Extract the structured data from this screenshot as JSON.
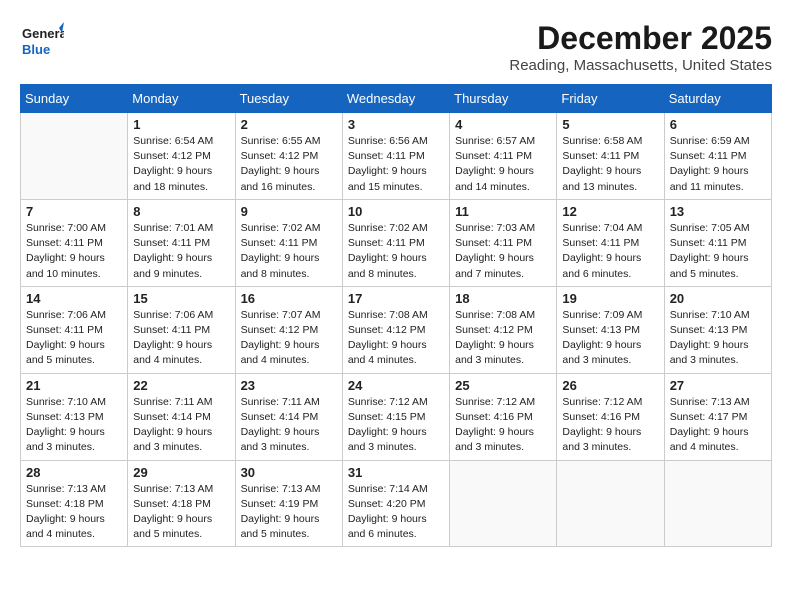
{
  "logo": {
    "line1": "General",
    "line2": "Blue"
  },
  "title": "December 2025",
  "location": "Reading, Massachusetts, United States",
  "days_of_week": [
    "Sunday",
    "Monday",
    "Tuesday",
    "Wednesday",
    "Thursday",
    "Friday",
    "Saturday"
  ],
  "weeks": [
    [
      {
        "day": "",
        "info": ""
      },
      {
        "day": "1",
        "info": "Sunrise: 6:54 AM\nSunset: 4:12 PM\nDaylight: 9 hours\nand 18 minutes."
      },
      {
        "day": "2",
        "info": "Sunrise: 6:55 AM\nSunset: 4:12 PM\nDaylight: 9 hours\nand 16 minutes."
      },
      {
        "day": "3",
        "info": "Sunrise: 6:56 AM\nSunset: 4:11 PM\nDaylight: 9 hours\nand 15 minutes."
      },
      {
        "day": "4",
        "info": "Sunrise: 6:57 AM\nSunset: 4:11 PM\nDaylight: 9 hours\nand 14 minutes."
      },
      {
        "day": "5",
        "info": "Sunrise: 6:58 AM\nSunset: 4:11 PM\nDaylight: 9 hours\nand 13 minutes."
      },
      {
        "day": "6",
        "info": "Sunrise: 6:59 AM\nSunset: 4:11 PM\nDaylight: 9 hours\nand 11 minutes."
      }
    ],
    [
      {
        "day": "7",
        "info": "Sunrise: 7:00 AM\nSunset: 4:11 PM\nDaylight: 9 hours\nand 10 minutes."
      },
      {
        "day": "8",
        "info": "Sunrise: 7:01 AM\nSunset: 4:11 PM\nDaylight: 9 hours\nand 9 minutes."
      },
      {
        "day": "9",
        "info": "Sunrise: 7:02 AM\nSunset: 4:11 PM\nDaylight: 9 hours\nand 8 minutes."
      },
      {
        "day": "10",
        "info": "Sunrise: 7:02 AM\nSunset: 4:11 PM\nDaylight: 9 hours\nand 8 minutes."
      },
      {
        "day": "11",
        "info": "Sunrise: 7:03 AM\nSunset: 4:11 PM\nDaylight: 9 hours\nand 7 minutes."
      },
      {
        "day": "12",
        "info": "Sunrise: 7:04 AM\nSunset: 4:11 PM\nDaylight: 9 hours\nand 6 minutes."
      },
      {
        "day": "13",
        "info": "Sunrise: 7:05 AM\nSunset: 4:11 PM\nDaylight: 9 hours\nand 5 minutes."
      }
    ],
    [
      {
        "day": "14",
        "info": "Sunrise: 7:06 AM\nSunset: 4:11 PM\nDaylight: 9 hours\nand 5 minutes."
      },
      {
        "day": "15",
        "info": "Sunrise: 7:06 AM\nSunset: 4:11 PM\nDaylight: 9 hours\nand 4 minutes."
      },
      {
        "day": "16",
        "info": "Sunrise: 7:07 AM\nSunset: 4:12 PM\nDaylight: 9 hours\nand 4 minutes."
      },
      {
        "day": "17",
        "info": "Sunrise: 7:08 AM\nSunset: 4:12 PM\nDaylight: 9 hours\nand 4 minutes."
      },
      {
        "day": "18",
        "info": "Sunrise: 7:08 AM\nSunset: 4:12 PM\nDaylight: 9 hours\nand 3 minutes."
      },
      {
        "day": "19",
        "info": "Sunrise: 7:09 AM\nSunset: 4:13 PM\nDaylight: 9 hours\nand 3 minutes."
      },
      {
        "day": "20",
        "info": "Sunrise: 7:10 AM\nSunset: 4:13 PM\nDaylight: 9 hours\nand 3 minutes."
      }
    ],
    [
      {
        "day": "21",
        "info": "Sunrise: 7:10 AM\nSunset: 4:13 PM\nDaylight: 9 hours\nand 3 minutes."
      },
      {
        "day": "22",
        "info": "Sunrise: 7:11 AM\nSunset: 4:14 PM\nDaylight: 9 hours\nand 3 minutes."
      },
      {
        "day": "23",
        "info": "Sunrise: 7:11 AM\nSunset: 4:14 PM\nDaylight: 9 hours\nand 3 minutes."
      },
      {
        "day": "24",
        "info": "Sunrise: 7:12 AM\nSunset: 4:15 PM\nDaylight: 9 hours\nand 3 minutes."
      },
      {
        "day": "25",
        "info": "Sunrise: 7:12 AM\nSunset: 4:16 PM\nDaylight: 9 hours\nand 3 minutes."
      },
      {
        "day": "26",
        "info": "Sunrise: 7:12 AM\nSunset: 4:16 PM\nDaylight: 9 hours\nand 3 minutes."
      },
      {
        "day": "27",
        "info": "Sunrise: 7:13 AM\nSunset: 4:17 PM\nDaylight: 9 hours\nand 4 minutes."
      }
    ],
    [
      {
        "day": "28",
        "info": "Sunrise: 7:13 AM\nSunset: 4:18 PM\nDaylight: 9 hours\nand 4 minutes."
      },
      {
        "day": "29",
        "info": "Sunrise: 7:13 AM\nSunset: 4:18 PM\nDaylight: 9 hours\nand 5 minutes."
      },
      {
        "day": "30",
        "info": "Sunrise: 7:13 AM\nSunset: 4:19 PM\nDaylight: 9 hours\nand 5 minutes."
      },
      {
        "day": "31",
        "info": "Sunrise: 7:14 AM\nSunset: 4:20 PM\nDaylight: 9 hours\nand 6 minutes."
      },
      {
        "day": "",
        "info": ""
      },
      {
        "day": "",
        "info": ""
      },
      {
        "day": "",
        "info": ""
      }
    ]
  ]
}
